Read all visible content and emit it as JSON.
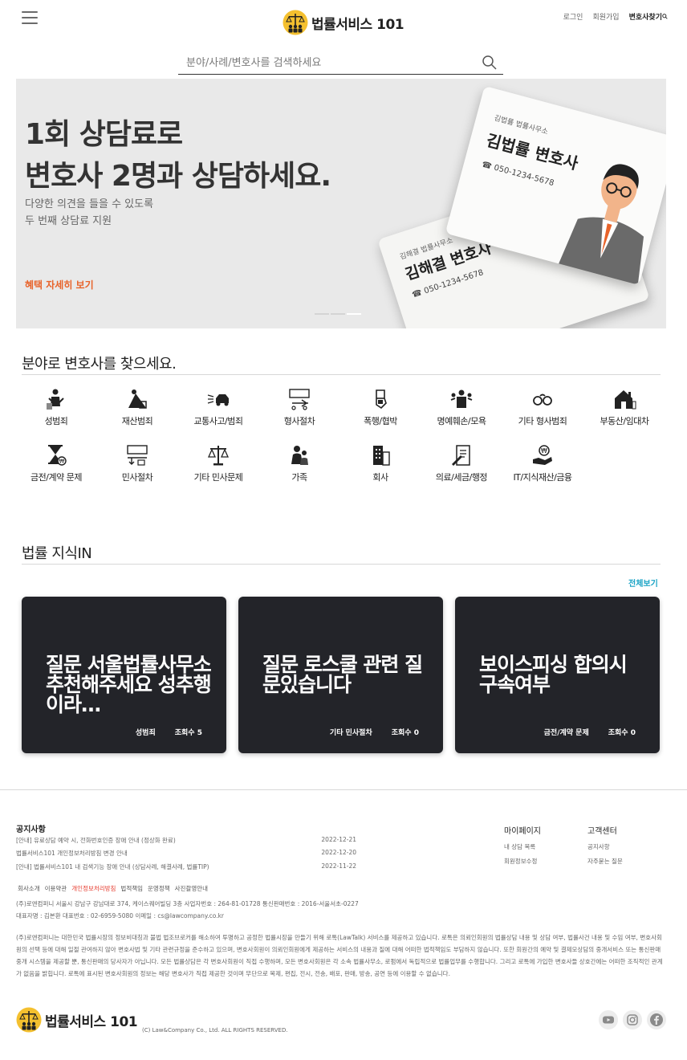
{
  "header": {
    "logo_text": "법률서비스 101",
    "links": {
      "login": "로그인",
      "signup": "회원가입",
      "find_lawyer": "변호사찾기"
    },
    "search_placeholder": "분야/사례/변호사를 검색하세요"
  },
  "banner": {
    "headline": "1회 상담료로\n변호사 2명과 상담하세요.",
    "subtext": "다양한 의견을 들을 수 있도록\n두 번째 상담료 지원",
    "cta": "혜택 자세히 보기",
    "card_front": {
      "office": "김법률 법률사무소",
      "name": "김법률 변호사",
      "phone": "050-1234-5678"
    },
    "card_back": {
      "office": "김해결 법률사무소",
      "name": "김해결 변호사",
      "phone": "050-1234-5678"
    }
  },
  "categories_section": {
    "title": "분야로 변호사를 찾으세요.",
    "items": [
      {
        "label": "성범죄",
        "icon": "sex-crime-icon"
      },
      {
        "label": "재산범죄",
        "icon": "property-crime-icon"
      },
      {
        "label": "교통사고/범죄",
        "icon": "traffic-accident-icon"
      },
      {
        "label": "형사절차",
        "icon": "criminal-procedure-icon"
      },
      {
        "label": "폭행/협박",
        "icon": "assault-icon"
      },
      {
        "label": "명예훼손/모욕",
        "icon": "defamation-icon"
      },
      {
        "label": "기타 형사범죄",
        "icon": "handcuffs-icon"
      },
      {
        "label": "부동산/임대차",
        "icon": "house-icon"
      },
      {
        "label": "금전/계약 문제",
        "icon": "money-contract-icon"
      },
      {
        "label": "민사절차",
        "icon": "civil-procedure-icon"
      },
      {
        "label": "기타 민사문제",
        "icon": "scales-icon"
      },
      {
        "label": "가족",
        "icon": "family-icon"
      },
      {
        "label": "회사",
        "icon": "building-icon"
      },
      {
        "label": "의료/세금/행정",
        "icon": "document-icon"
      },
      {
        "label": "IT/지식재산/금융",
        "icon": "finance-icon"
      }
    ]
  },
  "knowledge_section": {
    "title": "법률 지식IN",
    "more": "전체보기",
    "cards": [
      {
        "question": "질문 서울법률사무소 추천해주세요 성추행이라…",
        "category": "성범죄",
        "views": "조회수 5"
      },
      {
        "question": "질문 로스쿨 관련 질문있습니다",
        "category": "기타 민사절차",
        "views": "조회수 0"
      },
      {
        "question": "보이스피싱 합의시 구속여부",
        "category": "금전/계약 문제",
        "views": "조회수 0"
      }
    ]
  },
  "footer": {
    "notice_title": "공지사항",
    "notices": [
      {
        "title": "[안내] 유료상담 예약 시, 전화번호인증 장애 안내 (정상화 완료)",
        "date": "2022-12-21"
      },
      {
        "title": "법률서비스101 개인정보처리방침 변경 안내",
        "date": "2022-12-20"
      },
      {
        "title": "[안내] 법률서비스101 내 검색기능 장애 안내 (상담사례, 해결사례, 법률TIP)",
        "date": "2022-11-22"
      }
    ],
    "mypage": {
      "title": "마이페이지",
      "links": [
        "내 상담 목록",
        "회원정보수정"
      ]
    },
    "support": {
      "title": "고객센터",
      "links": [
        "공지사항",
        "자주묻는 질문"
      ]
    },
    "policy_links": [
      "회사소개",
      "이용약관",
      "개인정보처리방침",
      "법적책임",
      "운영정책",
      "사진촬영안내"
    ],
    "corp_info": "(주)로앤컴퍼니 서울시 강남구 강남대로 374, 케이스퀘어빌딩 3층 사업자번호 : 264-81-01728 통신판매번호 : 2016-서울서초-0227\n대표자명 : 김본환 대표번호 : 02-6959-5080 이메일 : cs@lawcompany.co.kr",
    "disclaimer": "(주)로앤컴퍼니는 대한민국 법률시장의 정보비대칭과 불법 법조브로커를 해소하여 투명하고 공정한 법률시장을 만들기 위해 로톡(LawTalk) 서비스를 제공하고 있습니다. 로톡은 의뢰인회원의 법률상담 내용 및 상담 여부, 법률사건 내용 및 수임 여부, 변호사회원의 선택 등에 대해 일절 관여하지 않아 변호사법 및 기타 관련규정을 준수하고 있으며, 변호사회원이 의뢰인회원에게 제공하는 서비스의 내용과 질에 대해 어떠한 법적책임도 부담하지 않습니다. 또한 회원간의 예약 및 결제모상담의 중개서비스 또는 통신판매중개 시스템을 제공할 뿐, 통신판매의 당사자가 아닙니다. 모든 법률상담은 각 변호사회원이 직접 수행하며, 모든 변호사회원은 각 소속 법률사무소, 로펌에서 독립적으로 법률업무를 수행합니다. 그리고 로톡에 가입한 변호사들 상호간에는 어떠한 조직적인 관계가 없음을 밝힙니다. 로톡에 표시된 변호사회원의 정보는 해당 변호사가 직접 제공한 것이며 무단으로 복제, 편집, 전시, 전송, 배포, 판매, 방송, 공연 등에 이용할 수 없습니다.",
    "logo_text": "법률서비스 101",
    "copyright": "(C) Law&Company Co., Ltd. ALL RIGHTS RESERVED.",
    "social": [
      "youtube-icon",
      "instagram-icon",
      "facebook-icon"
    ]
  },
  "colors": {
    "accent": "#e8632a",
    "link": "#1aa3c5",
    "card_bg": "#232429",
    "policy_red": "#e63a2d"
  }
}
